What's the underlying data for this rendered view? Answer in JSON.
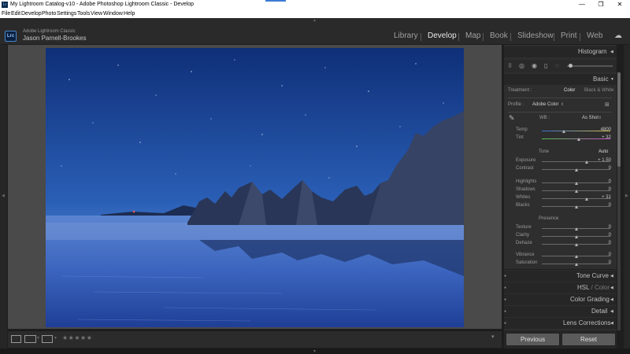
{
  "window": {
    "title": "My Lightroom Catalog-v10 - Adobe Photoshop Lightroom Classic - Develop",
    "app_icon": "Lr",
    "controls": [
      "—",
      "❐",
      "✕"
    ]
  },
  "menu": [
    "File",
    "Edit",
    "Develop",
    "Photo",
    "Settings",
    "Tools",
    "View",
    "Window",
    "Help"
  ],
  "identity": {
    "logo": "Lrc",
    "product": "Adobe Lightroom Classic",
    "user": "Jason Parnell-Brookes"
  },
  "modules": [
    {
      "label": "Library"
    },
    {
      "label": "Develop"
    },
    {
      "label": "Map"
    },
    {
      "label": "Book"
    },
    {
      "label": "Slideshow"
    },
    {
      "label": "Print"
    },
    {
      "label": "Web"
    }
  ],
  "active_module": "Develop",
  "panels": {
    "histogram": "Histogram",
    "basic": "Basic",
    "tone_curve": "Tone Curve",
    "hsl": "HSL",
    "hsl_sep": " / ",
    "color": "Color",
    "color_grading": "Color Grading",
    "detail": "Detail",
    "lens": "Lens Corrections"
  },
  "basic": {
    "treatment_label": "Treatment :",
    "treatment_color": "Color",
    "treatment_bw": "Black & White",
    "profile_label": "Profile :",
    "profile_value": "Adobe Color",
    "profile_arrows": "⇕",
    "wb_label": "WB :",
    "wb_value": "As Shot",
    "wb_arrows": "⇕",
    "tone_label": "Tone",
    "auto_label": "Auto",
    "presence_label": "Presence",
    "sliders_wb": [
      {
        "label": "Temp",
        "value": "4800",
        "pos": 0.32
      },
      {
        "label": "Tint",
        "value": "+ 32",
        "pos": 0.54
      }
    ],
    "sliders_tone": [
      {
        "label": "Exposure",
        "value": "+ 1.50",
        "pos": 0.65
      },
      {
        "label": "Contrast",
        "value": "0",
        "pos": 0.5
      },
      {
        "label": "Highlights",
        "value": "0",
        "pos": 0.5
      },
      {
        "label": "Shadows",
        "value": "0",
        "pos": 0.5
      },
      {
        "label": "Whites",
        "value": "+ 31",
        "pos": 0.65
      },
      {
        "label": "Blacks",
        "value": "0",
        "pos": 0.5
      }
    ],
    "sliders_presence": [
      {
        "label": "Texture",
        "value": "0",
        "pos": 0.5
      },
      {
        "label": "Clarity",
        "value": "0",
        "pos": 0.5
      },
      {
        "label": "Dehaze",
        "value": "0",
        "pos": 0.5
      },
      {
        "label": "Vibrance",
        "value": "0",
        "pos": 0.5
      },
      {
        "label": "Saturation",
        "value": "0",
        "pos": 0.5
      }
    ]
  },
  "buttons": {
    "previous": "Previous",
    "reset": "Reset"
  },
  "toolbar": {
    "stars": "★★★★★"
  },
  "colors": {
    "sky_top": "#13337a",
    "sky_mid": "#2b60b8",
    "sea": "#3d67c0",
    "panel": "#2e2e2e"
  }
}
